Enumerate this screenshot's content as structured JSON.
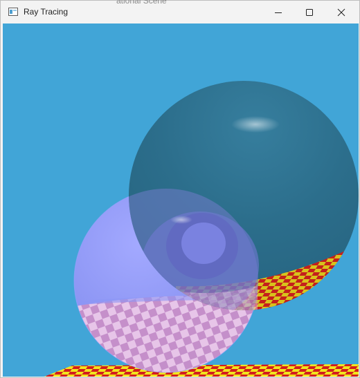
{
  "window": {
    "title": "Ray Tracing",
    "background_title_fragment": "ational Scene",
    "controls": {
      "minimize_icon": "minimize-icon",
      "maximize_icon": "maximize-icon",
      "close_icon": "close-icon"
    }
  },
  "scene": {
    "sky_color": "#41a5d7",
    "large_sphere_color": "#2a6d8b",
    "small_sphere_color": "#8c96f5",
    "checker_colors": [
      "#d31d1d",
      "#f1e51d"
    ],
    "reflection_checker_colors": [
      "#c88fc8",
      "#ecc8e8"
    ]
  }
}
